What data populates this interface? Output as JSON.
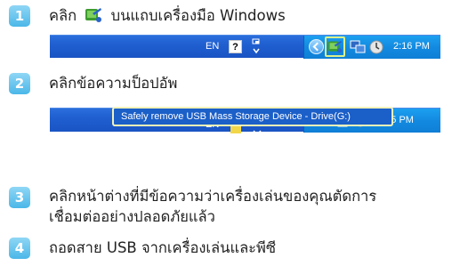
{
  "steps": [
    {
      "number": "1",
      "text_before": "คลิก",
      "text_after": "บนแถบเครื่องมือ Windows"
    },
    {
      "number": "2",
      "text": "คลิกข้อความป็อปอัพ"
    },
    {
      "number": "3",
      "line1": "คลิกหน้าต่างที่มีข้อความว่าเครื่องเล่นของคุณตัดการ",
      "line2": "เชื่อมต่ออย่างปลอดภัยแล้ว"
    },
    {
      "number": "4",
      "text": "ถอดสาย USB จากเครื่องเล่นและพีซี"
    }
  ],
  "taskbar1": {
    "language": "EN",
    "help": "?",
    "time": "2:16 PM"
  },
  "taskbar2": {
    "language": "EN",
    "time": "2:15 PM",
    "popup": "Safely remove USB Mass Storage Device - Drive(G:)"
  },
  "colors": {
    "badge": "#4bb7e8",
    "taskbar": "#1f5fd0",
    "tray": "#138ae0",
    "highlight": "#dcef8a"
  },
  "icons": [
    "safely-remove-hardware-icon",
    "help-icon",
    "chevron-left-icon",
    "network-icon",
    "clock-icon",
    "keyboard-icon"
  ]
}
